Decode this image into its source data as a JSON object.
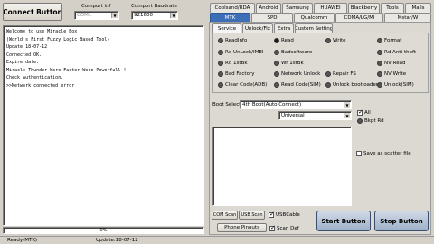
{
  "header": {
    "connect_button": "Connect Button",
    "comport_int_label": "Comport inf",
    "comport_int_value": "COM1",
    "comport_baud_label": "Comport Baudrate",
    "comport_baud_value": "921600"
  },
  "log_lines": [
    "Welcome to use Miracle Box",
    "(World's First Fuzzy Logic Based Tool)",
    "Update:18-07-12",
    "Connected OK.",
    "Expire date:",
    "Miracle Thunder Were Faster Were Powerfull !",
    "Check Authentication.",
    ">>Network connected error"
  ],
  "progress": {
    "text": "0%",
    "value": 0
  },
  "status_bar": {
    "left": "Ready(MTK)",
    "update": "Update:18-07-12"
  },
  "main_tabs_row1": [
    "Coolsand/RDA",
    "Android",
    "Samsung",
    "HUAWEI",
    "Blackberry",
    "Tools",
    "Mails"
  ],
  "main_tabs_row2": [
    "MTK",
    "SPD",
    "Qualcomm",
    "CDMA/LG/MI",
    "Mstar/W"
  ],
  "active_main_tab": "MTK",
  "sub_tabs": [
    "Service",
    "Unlock/Fix",
    "Extra",
    "Custom Setting"
  ],
  "active_sub_tab": "Service",
  "radio_options": [
    [
      "ReadInfo",
      "Read",
      "Write",
      "Format"
    ],
    [
      "Rd UnLock/IMEI",
      "Badsoftware",
      "",
      "Rd Anti-theft"
    ],
    [
      "Rd 1stBk",
      "Wr 1stBk",
      "",
      "NV Read"
    ],
    [
      "Bad Factory",
      "Network Unlock",
      "Repair FS",
      "NV Write"
    ],
    [
      "Clear Code(ADB)",
      "Read Code(SIM)",
      "Unlock bootloader",
      "Unlock(SIM)"
    ]
  ],
  "selected_radio": "Read",
  "boot_select": {
    "label": "Boot Select:",
    "value": "4th Boot(Auto Connect)"
  },
  "universal_select": "Universal",
  "checkboxes": {
    "all": "All",
    "bkpt_rd": "Bkpt Rd",
    "save_scatter": "Save as scatter file"
  },
  "bottom": {
    "com_scan": "COM Scan",
    "usb_scan": "USB Scan",
    "usb_cable": "USBCable",
    "phone_pinouts": "Phone Pinouts",
    "scan_def": "Scan Def",
    "start_button": "Start Button",
    "stop_button": "Stop Button"
  }
}
